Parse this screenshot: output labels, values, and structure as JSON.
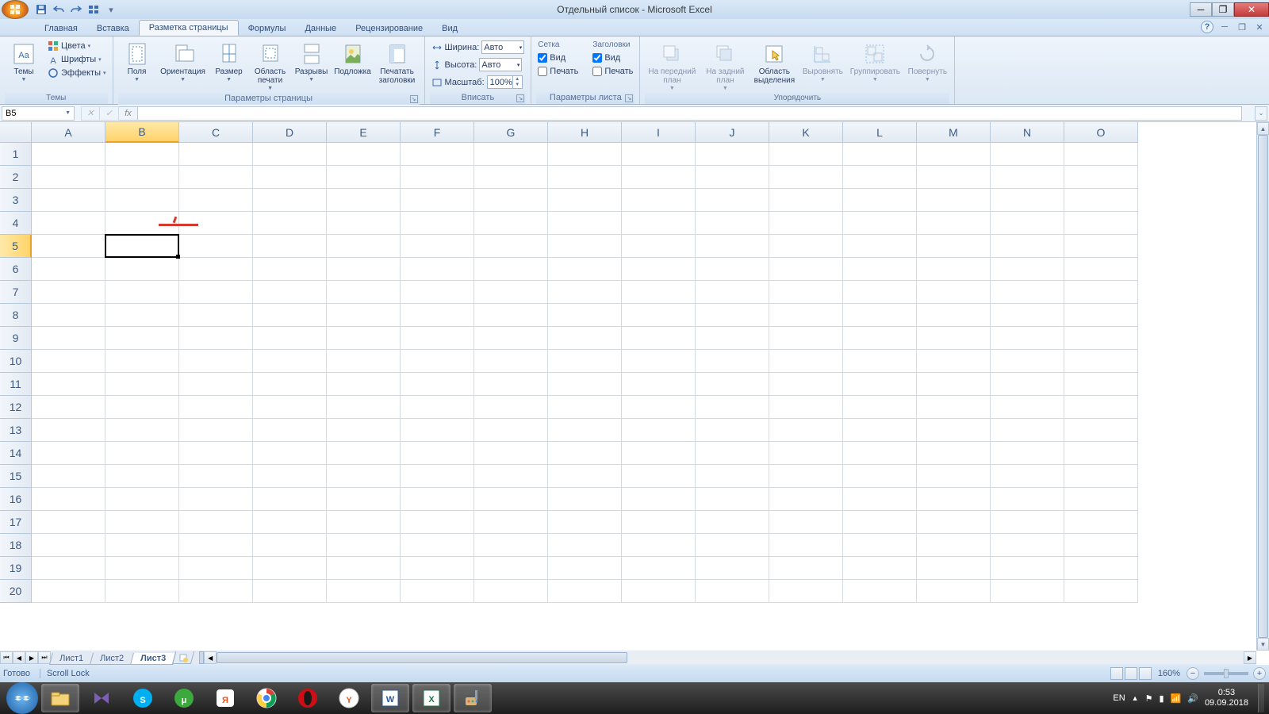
{
  "title": "Отдельный список - Microsoft Excel",
  "tabs": [
    "Главная",
    "Вставка",
    "Разметка страницы",
    "Формулы",
    "Данные",
    "Рецензирование",
    "Вид"
  ],
  "active_tab": 2,
  "ribbon": {
    "themes": {
      "label": "Темы",
      "main": "Темы",
      "colors": "Цвета",
      "fonts": "Шрифты",
      "effects": "Эффекты"
    },
    "page_setup": {
      "label": "Параметры страницы",
      "margins": "Поля",
      "orientation": "Ориентация",
      "size": "Размер",
      "print_area": "Область печати",
      "breaks": "Разрывы",
      "background": "Подложка",
      "print_titles": "Печатать заголовки"
    },
    "scale": {
      "label": "Вписать",
      "width_l": "Ширина:",
      "width_v": "Авто",
      "height_l": "Высота:",
      "height_v": "Авто",
      "scale_l": "Масштаб:",
      "scale_v": "100%"
    },
    "sheet_opts": {
      "label": "Параметры листа",
      "grid_h": "Сетка",
      "titles_h": "Заголовки",
      "view_l": "Вид",
      "print_l": "Печать",
      "grid_view": true,
      "grid_print": false,
      "titles_view": true,
      "titles_print": false
    },
    "arrange": {
      "label": "Упорядочить",
      "bring_front": "На передний план",
      "send_back": "На задний план",
      "selection_pane": "Область выделения",
      "align": "Выровнять",
      "group": "Группировать",
      "rotate": "Повернуть"
    }
  },
  "name_box": "B5",
  "formula": "",
  "columns": [
    "A",
    "B",
    "C",
    "D",
    "E",
    "F",
    "G",
    "H",
    "I",
    "J",
    "K",
    "L",
    "M",
    "N",
    "O"
  ],
  "rows": [
    1,
    2,
    3,
    4,
    5,
    6,
    7,
    8,
    9,
    10,
    11,
    12,
    13,
    14,
    15,
    16,
    17,
    18,
    19,
    20
  ],
  "selected_col": 1,
  "selected_row": 4,
  "sheets": [
    "Лист1",
    "Лист2",
    "Лист3"
  ],
  "active_sheet": 2,
  "status": {
    "ready": "Готово",
    "scroll": "Scroll Lock",
    "zoom": "160%"
  },
  "taskbar": {
    "lang": "EN",
    "time": "0:53",
    "date": "09.09.2018"
  }
}
